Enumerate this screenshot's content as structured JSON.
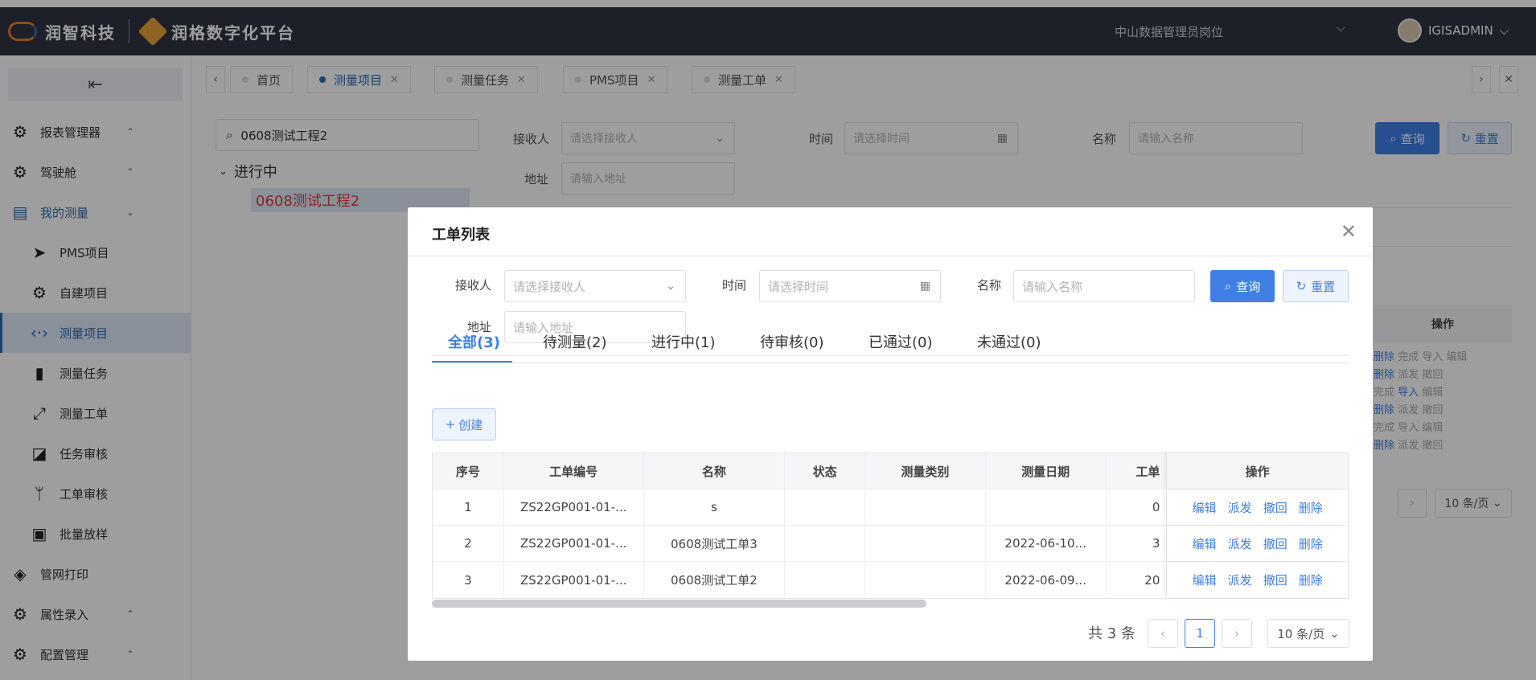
{
  "header": {
    "brand_primary": "润智科技",
    "brand_secondary": "润格数字化平台",
    "role": "中山数据管理员岗位",
    "username": "IGISADMIN"
  },
  "sidebar": {
    "items": [
      {
        "label": "报表管理器",
        "icon": "gear-icon"
      },
      {
        "label": "驾驶舱",
        "icon": "gear-icon"
      },
      {
        "label": "我的测量",
        "icon": "folder-icon"
      },
      {
        "label": "PMS项目",
        "icon": "send-icon"
      },
      {
        "label": "自建项目",
        "icon": "gear-icon"
      },
      {
        "label": "测量项目",
        "icon": "code-icon"
      },
      {
        "label": "测量任务",
        "icon": "bookmark-icon"
      },
      {
        "label": "测量工单",
        "icon": "ruler-icon"
      },
      {
        "label": "任务审核",
        "icon": "chart-icon"
      },
      {
        "label": "工单审核",
        "icon": "branch-icon"
      },
      {
        "label": "批量放样",
        "icon": "trash-icon"
      },
      {
        "label": "管网打印",
        "icon": "layers-icon"
      },
      {
        "label": "属性录入",
        "icon": "gear-icon"
      },
      {
        "label": "配置管理",
        "icon": "gear-icon"
      }
    ]
  },
  "tabs": [
    {
      "label": "首页"
    },
    {
      "label": "测量项目"
    },
    {
      "label": "测量任务"
    },
    {
      "label": "PMS项目"
    },
    {
      "label": "测量工单"
    }
  ],
  "tree": {
    "search_value": "0608测试工程2",
    "group": "进行中",
    "leaf": "0608测试工程2"
  },
  "background": {
    "receiver_label": "接收人",
    "receiver_placeholder": "请选择接收人",
    "time_label": "时间",
    "time_placeholder": "请选择时间",
    "name_label": "名称",
    "name_placeholder": "请输入名称",
    "address_label": "地址",
    "address_placeholder": "请输入地址",
    "query": "查询",
    "reset": "重置",
    "ops_header": "操作",
    "page_size": "10 条/页",
    "row_ops": [
      [
        "删除",
        "完成",
        "导入",
        "编辑"
      ],
      [
        "删除",
        "派发",
        "撤回"
      ],
      [
        "完成",
        "导入",
        "编辑"
      ],
      [
        "删除",
        "派发",
        "撤回"
      ],
      [
        "完成",
        "导入",
        "编辑"
      ],
      [
        "删除",
        "派发",
        "撤回"
      ]
    ]
  },
  "modal": {
    "title": "工单列表",
    "filters": {
      "receiver_label": "接收人",
      "receiver_placeholder": "请选择接收人",
      "time_label": "时间",
      "time_placeholder": "请选择时间",
      "name_label": "名称",
      "name_placeholder": "请输入名称",
      "address_label": "地址",
      "address_placeholder": "请输入地址",
      "query": "查询",
      "reset": "重置"
    },
    "status_tabs": [
      "全部(3)",
      "待测量(2)",
      "进行中(1)",
      "待审核(0)",
      "已通过(0)",
      "未通过(0)"
    ],
    "create": "创建",
    "table": {
      "headers": [
        "序号",
        "工单编号",
        "名称",
        "状态",
        "测量类别",
        "测量日期",
        "工单",
        "操作"
      ],
      "rows": [
        [
          "1",
          "ZS22GP001-01-...",
          "s",
          "",
          "",
          "",
          "0"
        ],
        [
          "2",
          "ZS22GP001-01-...",
          "0608测试工单3",
          "",
          "",
          "2022-06-10...",
          "3"
        ],
        [
          "3",
          "ZS22GP001-01-...",
          "0608测试工单2",
          "",
          "",
          "2022-06-09...",
          "20"
        ]
      ],
      "ops": [
        "编辑",
        "派发",
        "撤回",
        "删除"
      ]
    },
    "pager": {
      "total": "共 3 条",
      "current": "1",
      "page_size": "10 条/页"
    }
  }
}
